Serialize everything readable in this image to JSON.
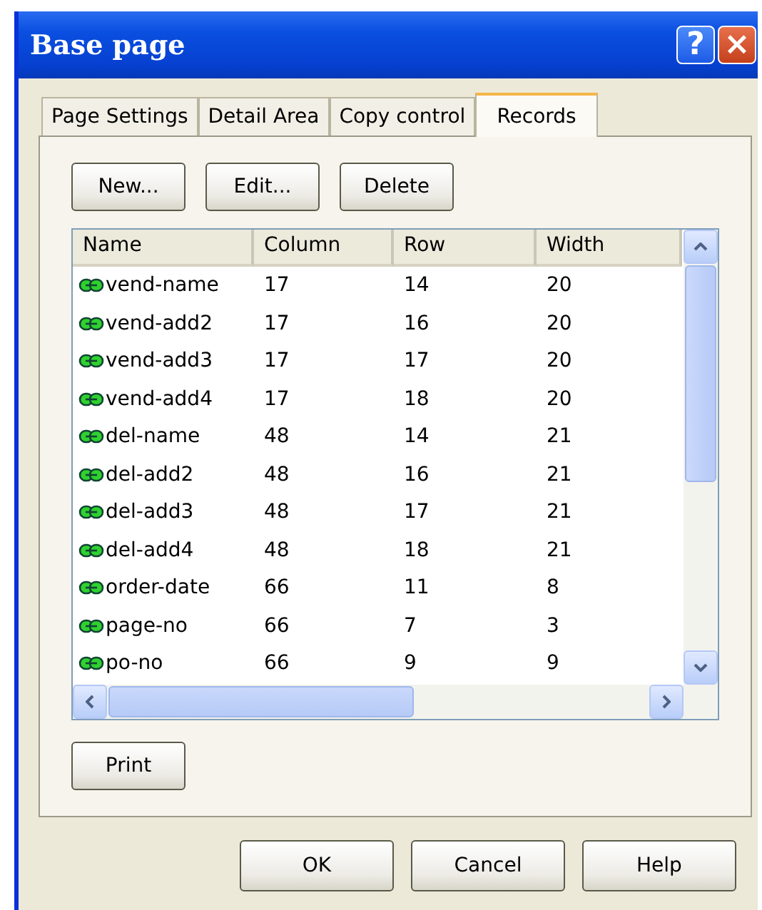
{
  "window": {
    "title": "Base page",
    "help_button": "?",
    "close_button": "×"
  },
  "tabs": [
    {
      "label": "Page Settings",
      "selected": false
    },
    {
      "label": "Detail Area",
      "selected": false
    },
    {
      "label": "Copy control",
      "selected": false
    },
    {
      "label": "Records",
      "selected": true
    }
  ],
  "toolbar": [
    "New...",
    "Edit...",
    "Delete"
  ],
  "table": {
    "columns": [
      "Name",
      "Column",
      "Row",
      "Width"
    ],
    "rows": [
      [
        "vend-name",
        "17",
        "14",
        "20"
      ],
      [
        "vend-add2",
        "17",
        "16",
        "20"
      ],
      [
        "vend-add3",
        "17",
        "17",
        "20"
      ],
      [
        "vend-add4",
        "17",
        "18",
        "20"
      ],
      [
        "del-name",
        "48",
        "14",
        "21"
      ],
      [
        "del-add2",
        "48",
        "16",
        "21"
      ],
      [
        "del-add3",
        "48",
        "17",
        "21"
      ],
      [
        "del-add4",
        "48",
        "18",
        "21"
      ],
      [
        "order-date",
        "66",
        "11",
        "8"
      ],
      [
        "page-no",
        "66",
        "7",
        "3"
      ],
      [
        "po-no",
        "66",
        "9",
        "9"
      ]
    ]
  },
  "print_button": "Print",
  "buttons": [
    "OK",
    "Cancel",
    "Help"
  ]
}
